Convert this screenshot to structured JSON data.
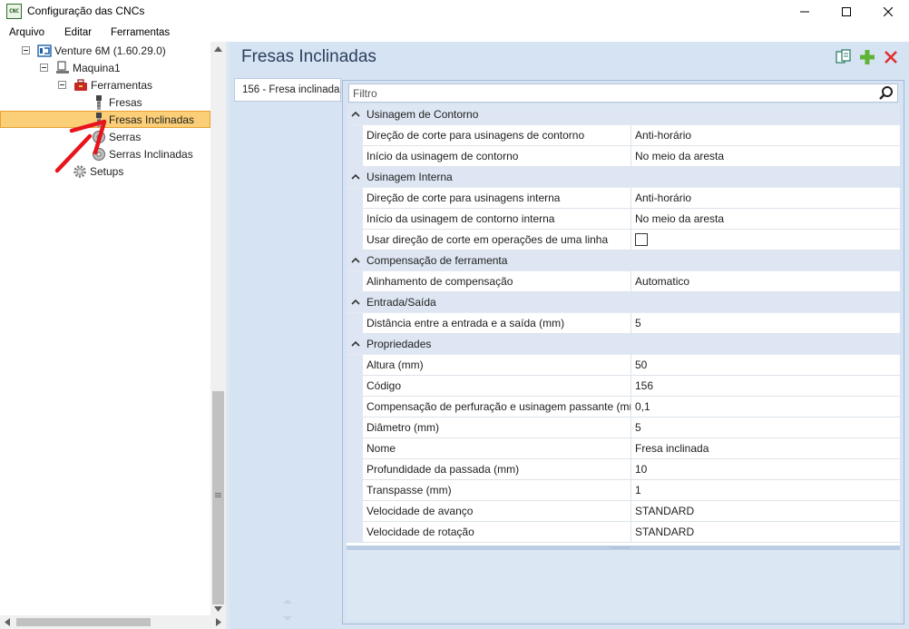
{
  "window": {
    "title": "Configuração das CNCs",
    "app_icon_text": "CNC"
  },
  "menu": [
    {
      "label": "Arquivo"
    },
    {
      "label": "Editar"
    },
    {
      "label": "Ferramentas"
    }
  ],
  "tree": {
    "root": "Venture 6M (1.60.29.0)",
    "machine": "Maquina1",
    "tools_folder": "Ferramentas",
    "items": {
      "fresas": "Fresas",
      "fresas_inclinadas": "Fresas Inclinadas",
      "serras": "Serras",
      "serras_inclinadas": "Serras Inclinadas"
    },
    "setups": "Setups"
  },
  "content": {
    "title": "Fresas Inclinadas",
    "tab_label": "156 - Fresa inclinada",
    "filter_placeholder": "Filtro"
  },
  "properties": {
    "cat1": "Usinagem de Contorno",
    "p1": {
      "name": "Direção de corte para usinagens de contorno",
      "value": "Anti-horário"
    },
    "p2": {
      "name": "Início da usinagem de contorno",
      "value": "No meio da aresta"
    },
    "cat2": "Usinagem Interna",
    "p3": {
      "name": "Direção de corte para usinagens interna",
      "value": "Anti-horário"
    },
    "p4": {
      "name": "Início da usinagem de contorno interna",
      "value": "No meio da aresta"
    },
    "p5": {
      "name": "Usar direção de corte em operações de uma linha",
      "checked": false
    },
    "cat3": "Compensação de ferramenta",
    "p6": {
      "name": "Alinhamento de compensação",
      "value": "Automatico"
    },
    "cat4": "Entrada/Saída",
    "p7": {
      "name": "Distância entre a entrada e a saída (mm)",
      "value": "5"
    },
    "cat5": "Propriedades",
    "p8": {
      "name": "Altura (mm)",
      "value": "50"
    },
    "p9": {
      "name": "Código",
      "value": "156"
    },
    "p10": {
      "name": "Compensação de perfuração e usinagem passante (mm)",
      "value": "0,1"
    },
    "p11": {
      "name": "Diâmetro (mm)",
      "value": "5"
    },
    "p12": {
      "name": "Nome",
      "value": "Fresa inclinada"
    },
    "p13": {
      "name": "Profundidade da passada (mm)",
      "value": "10"
    },
    "p14": {
      "name": "Transpasse (mm)",
      "value": "1"
    },
    "p15": {
      "name": "Velocidade de avanço",
      "value": "STANDARD"
    },
    "p16": {
      "name": "Velocidade de rotação",
      "value": "STANDARD"
    }
  },
  "colors": {
    "selection": "#fbcf78",
    "accent_blue": "#d6e3f3",
    "annotation_arrow": "#e8141b"
  },
  "icons": {
    "copy": "copy-icon",
    "add": "plus-icon",
    "delete": "close-icon",
    "search": "search-icon"
  }
}
